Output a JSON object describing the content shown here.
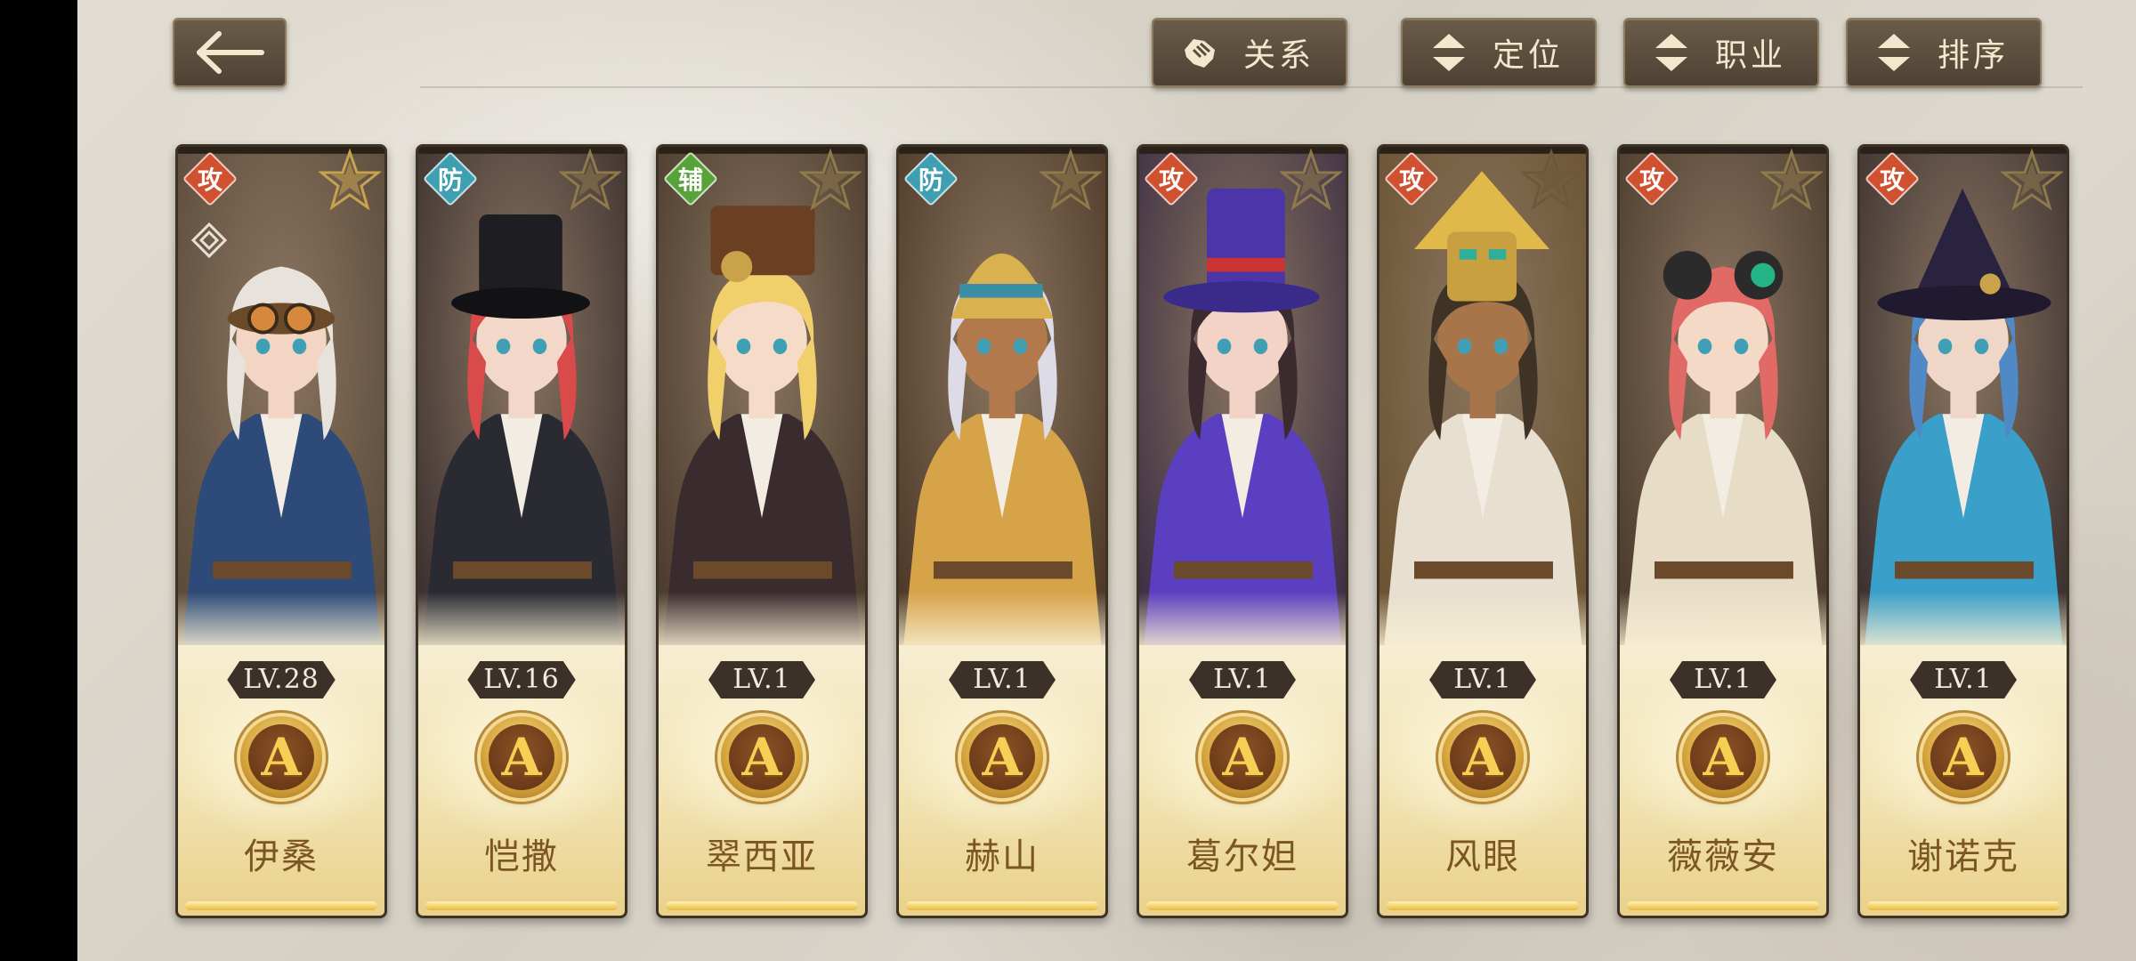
{
  "toolbar": {
    "back_icon": "arrow-left-icon",
    "relation_label": "关系",
    "position_label": "定位",
    "class_label": "职业",
    "sort_label": "排序"
  },
  "role_colors": {
    "攻": "#d0512f",
    "防": "#3e9fb0",
    "辅": "#58a23a"
  },
  "heroes": [
    {
      "role": "攻",
      "level": "LV.28",
      "grade": "A",
      "name": "伊桑",
      "hair": "#e7e3dc",
      "coat": "#2d4a78",
      "skin": "#f2d5c2",
      "bg": "#5a4a3a",
      "hat": "goggles",
      "star": "#c8a24f"
    },
    {
      "role": "防",
      "level": "LV.16",
      "grade": "A",
      "name": "恺撒",
      "hair": "#d94a4a",
      "coat": "#2a2a33",
      "skin": "#f3d7c9",
      "bg": "#3a2f2f",
      "hat": "tophat",
      "star": "#8f7a4b"
    },
    {
      "role": "辅",
      "level": "LV.1",
      "grade": "A",
      "name": "翠西亚",
      "hair": "#f1cf6b",
      "coat": "#3a2c2e",
      "skin": "#f6dcc8",
      "bg": "#4a3a2c",
      "hat": "book",
      "star": "#8f7a4b"
    },
    {
      "role": "防",
      "level": "LV.1",
      "grade": "A",
      "name": "赫山",
      "hair": "#dcdbe6",
      "coat": "#d7a349",
      "skin": "#b27a4c",
      "bg": "#4c3826",
      "hat": "headdress",
      "star": "#8f7a4b"
    },
    {
      "role": "攻",
      "level": "LV.1",
      "grade": "A",
      "name": "葛尔妲",
      "hair": "#3b2b2f",
      "coat": "#5a3fc0",
      "skin": "#f2d3c6",
      "bg": "#3c2e44",
      "hat": "purplehat",
      "star": "#8f7a4b"
    },
    {
      "role": "攻",
      "level": "LV.1",
      "grade": "A",
      "name": "风眼",
      "hair": "#3e3325",
      "coat": "#e7dfcf",
      "skin": "#a8754a",
      "bg": "#6a5230",
      "hat": "mask",
      "star": "#6a5a3a"
    },
    {
      "role": "攻",
      "level": "LV.1",
      "grade": "A",
      "name": "薇薇安",
      "hair": "#e26a66",
      "coat": "#e7ddc7",
      "skin": "#f5d9c7",
      "bg": "#4a3a2c",
      "hat": "horns",
      "star": "#8f7a4b"
    },
    {
      "role": "攻",
      "level": "LV.1",
      "grade": "A",
      "name": "谢诺克",
      "hair": "#4f8ac6",
      "coat": "#3aa0c9",
      "skin": "#f0d6c6",
      "bg": "#3a3030",
      "hat": "witchhat",
      "star": "#8f7a4b"
    }
  ]
}
